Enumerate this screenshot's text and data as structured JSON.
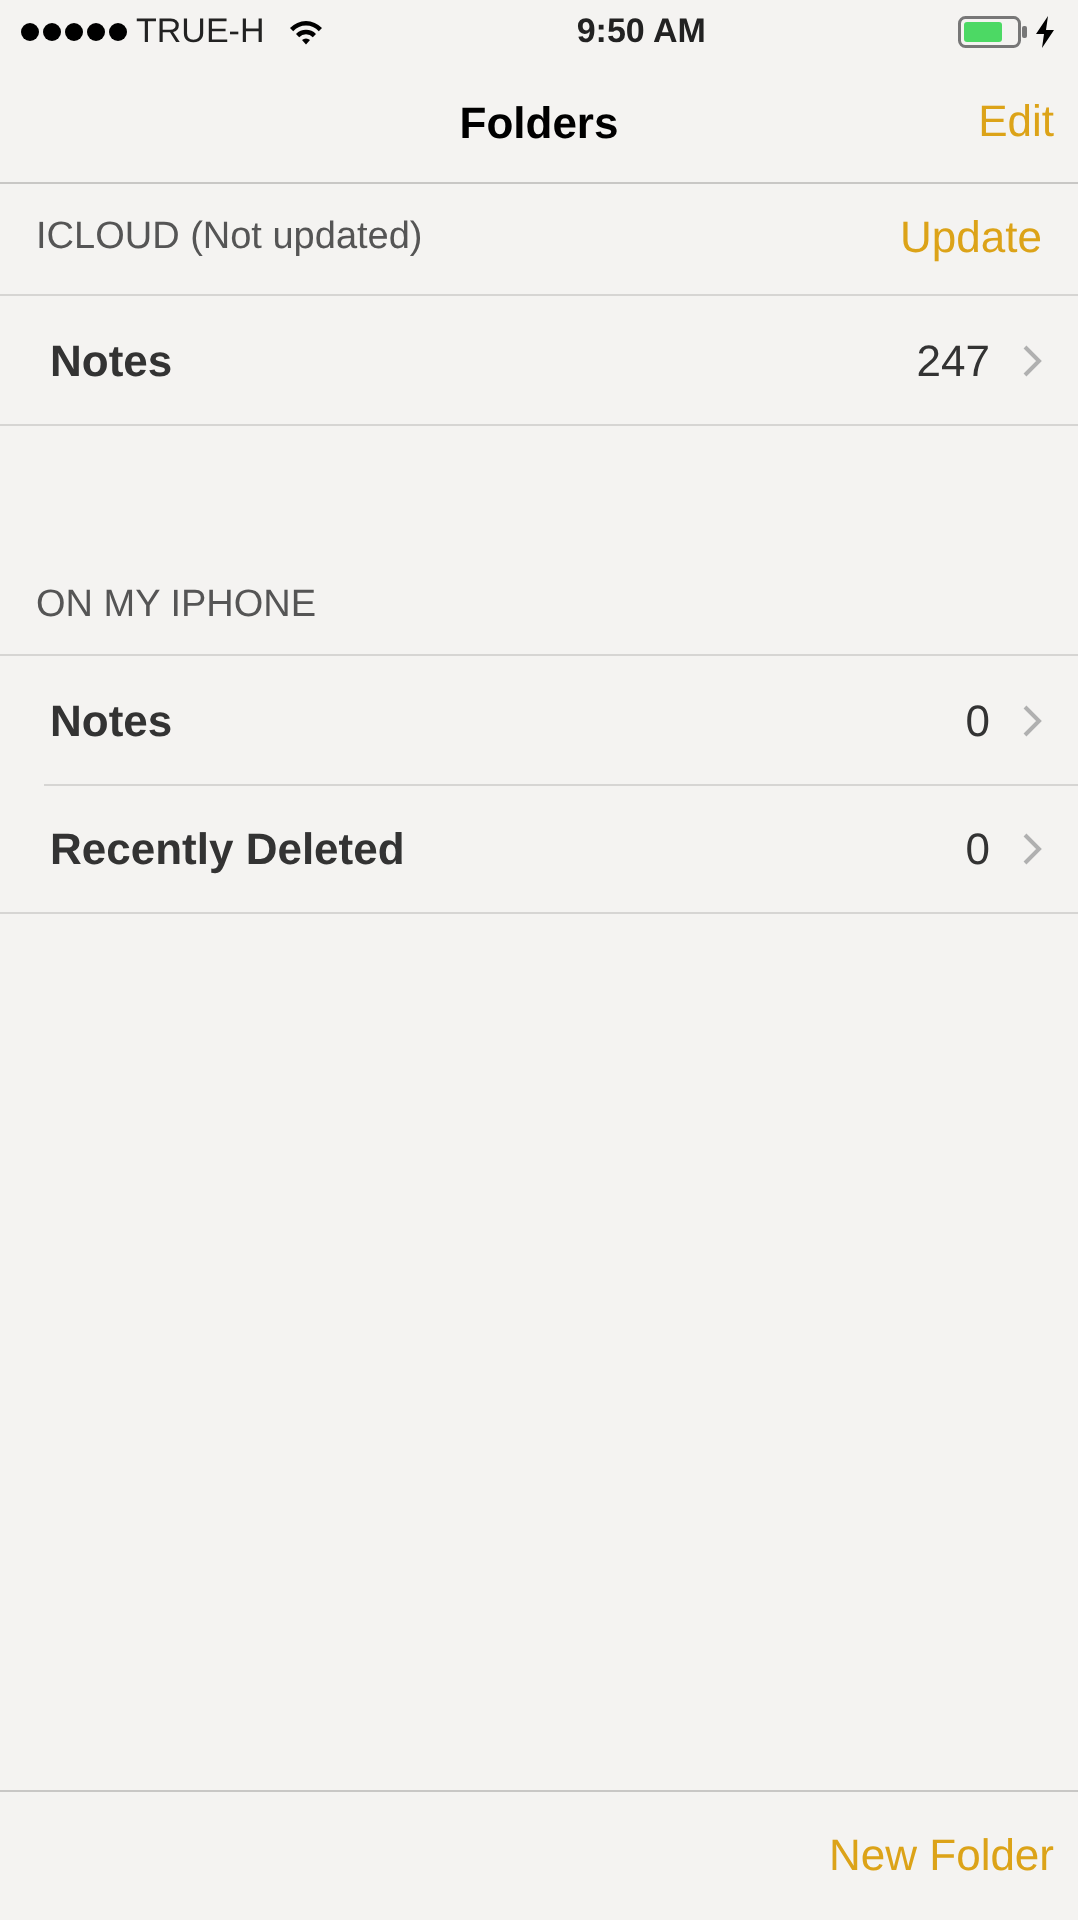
{
  "status_bar": {
    "carrier": "TRUE-H",
    "time": "9:50 AM",
    "charging": true
  },
  "nav_bar": {
    "title": "Folders",
    "right_button": "Edit"
  },
  "sections": [
    {
      "header": "ICLOUD (Not updated)",
      "action": "Update",
      "rows": [
        {
          "label": "Notes",
          "count": "247"
        }
      ]
    },
    {
      "header": "ON MY IPHONE",
      "rows": [
        {
          "label": "Notes",
          "count": "0"
        },
        {
          "label": "Recently Deleted",
          "count": "0"
        }
      ]
    }
  ],
  "toolbar": {
    "button": "New Folder"
  }
}
